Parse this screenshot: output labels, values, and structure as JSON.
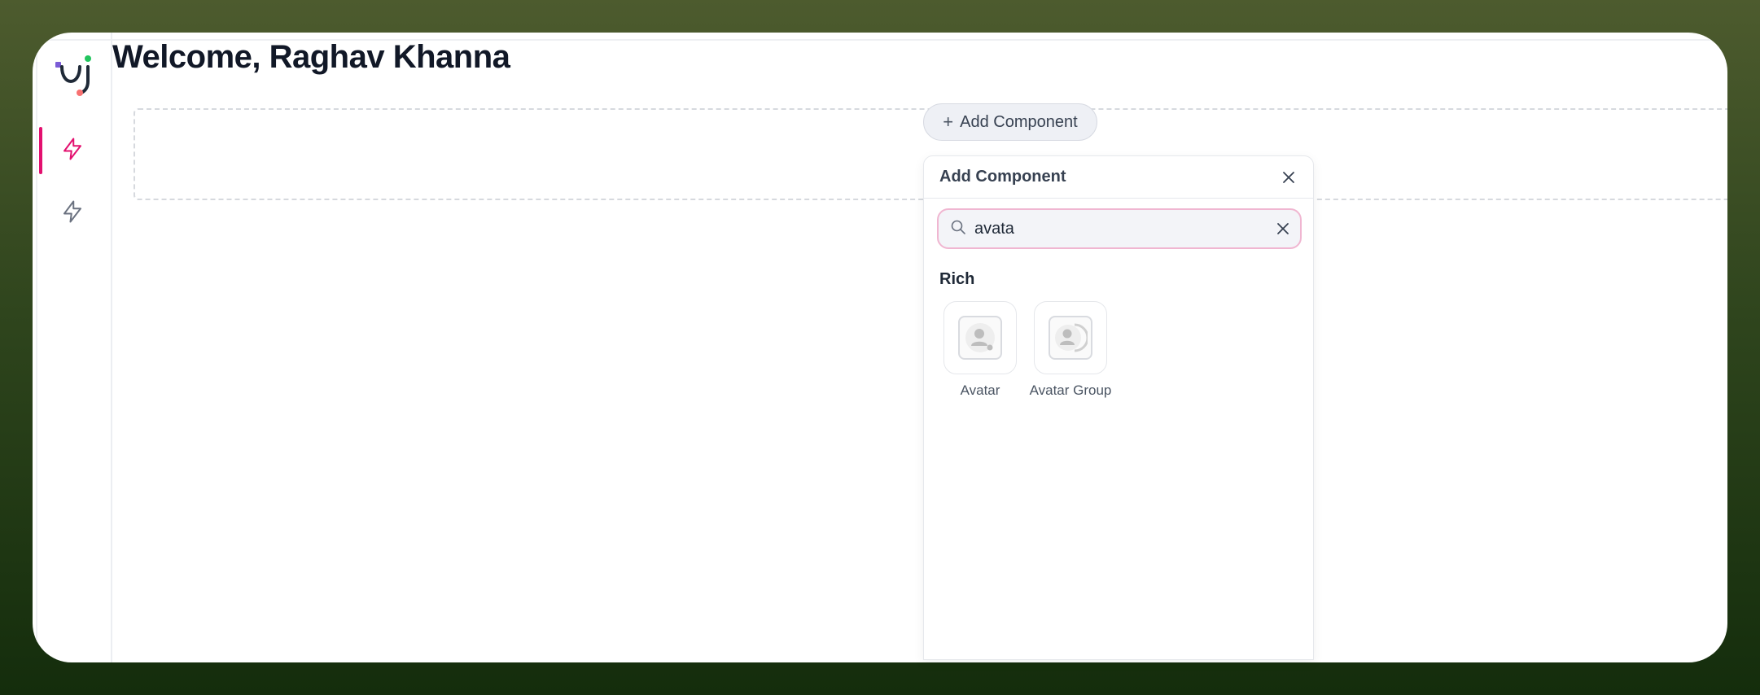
{
  "header": {
    "welcome": "Welcome, Raghav Khanna"
  },
  "toolbar": {
    "add_component_label": "Add Component"
  },
  "panel": {
    "title": "Add Component",
    "search": {
      "value": "avata",
      "placeholder": ""
    },
    "section": "Rich",
    "items": [
      {
        "label": "Avatar",
        "icon": "avatar-icon"
      },
      {
        "label": "Avatar Group",
        "icon": "avatar-group-icon"
      }
    ]
  },
  "sidebar": {
    "items": [
      {
        "icon": "lightning-icon",
        "active": true
      },
      {
        "icon": "lightning-icon",
        "active": false
      }
    ]
  },
  "colors": {
    "accent": "#e3106f",
    "search_border": "#f0b6d1",
    "title_text": "#111827"
  }
}
